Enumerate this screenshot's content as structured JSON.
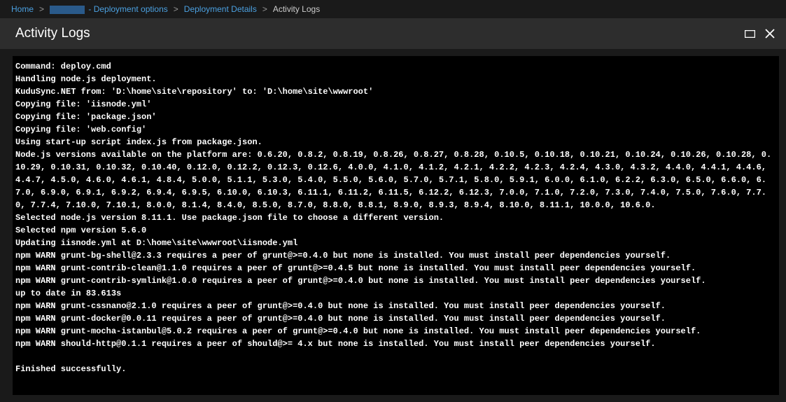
{
  "breadcrumb": {
    "home": "Home",
    "seg2_suffix": " - Deployment options",
    "seg3": "Deployment Details",
    "current": "Activity Logs"
  },
  "header": {
    "title": "Activity Logs"
  },
  "log": {
    "lines": [
      "Command: deploy.cmd",
      "Handling node.js deployment.",
      "KuduSync.NET from: 'D:\\home\\site\\repository' to: 'D:\\home\\site\\wwwroot'",
      "Copying file: 'iisnode.yml'",
      "Copying file: 'package.json'",
      "Copying file: 'web.config'",
      "Using start-up script index.js from package.json.",
      "Node.js versions available on the platform are: 0.6.20, 0.8.2, 0.8.19, 0.8.26, 0.8.27, 0.8.28, 0.10.5, 0.10.18, 0.10.21, 0.10.24, 0.10.26, 0.10.28, 0.10.29, 0.10.31, 0.10.32, 0.10.40, 0.12.0, 0.12.2, 0.12.3, 0.12.6, 4.0.0, 4.1.0, 4.1.2, 4.2.1, 4.2.2, 4.2.3, 4.2.4, 4.3.0, 4.3.2, 4.4.0, 4.4.1, 4.4.6, 4.4.7, 4.5.0, 4.6.0, 4.6.1, 4.8.4, 5.0.0, 5.1.1, 5.3.0, 5.4.0, 5.5.0, 5.6.0, 5.7.0, 5.7.1, 5.8.0, 5.9.1, 6.0.0, 6.1.0, 6.2.2, 6.3.0, 6.5.0, 6.6.0, 6.7.0, 6.9.0, 6.9.1, 6.9.2, 6.9.4, 6.9.5, 6.10.0, 6.10.3, 6.11.1, 6.11.2, 6.11.5, 6.12.2, 6.12.3, 7.0.0, 7.1.0, 7.2.0, 7.3.0, 7.4.0, 7.5.0, 7.6.0, 7.7.0, 7.7.4, 7.10.0, 7.10.1, 8.0.0, 8.1.4, 8.4.0, 8.5.0, 8.7.0, 8.8.0, 8.8.1, 8.9.0, 8.9.3, 8.9.4, 8.10.0, 8.11.1, 10.0.0, 10.6.0.",
      "Selected node.js version 8.11.1. Use package.json file to choose a different version.",
      "Selected npm version 5.6.0",
      "Updating iisnode.yml at D:\\home\\site\\wwwroot\\iisnode.yml",
      "npm WARN grunt-bg-shell@2.3.3 requires a peer of grunt@>=0.4.0 but none is installed. You must install peer dependencies yourself.",
      "npm WARN grunt-contrib-clean@1.1.0 requires a peer of grunt@>=0.4.5 but none is installed. You must install peer dependencies yourself.",
      "npm WARN grunt-contrib-symlink@1.0.0 requires a peer of grunt@>=0.4.0 but none is installed. You must install peer dependencies yourself.",
      "up to date in 83.613s",
      "npm WARN grunt-cssnano@2.1.0 requires a peer of grunt@>=0.4.0 but none is installed. You must install peer dependencies yourself.",
      "npm WARN grunt-docker@0.0.11 requires a peer of grunt@>=0.4.0 but none is installed. You must install peer dependencies yourself.",
      "npm WARN grunt-mocha-istanbul@5.0.2 requires a peer of grunt@>=0.4.0 but none is installed. You must install peer dependencies yourself.",
      "npm WARN should-http@0.1.1 requires a peer of should@>= 4.x but none is installed. You must install peer dependencies yourself.",
      "",
      "Finished successfully."
    ]
  }
}
